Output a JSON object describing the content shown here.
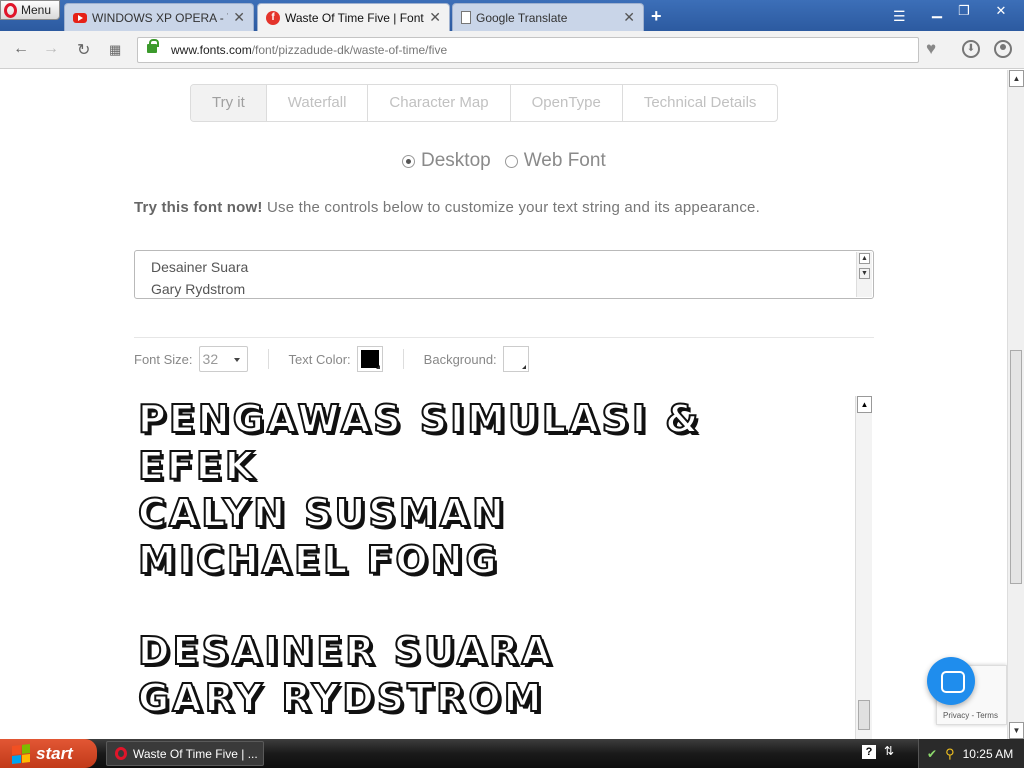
{
  "browser": {
    "menu_label": "Menu",
    "tabs": [
      {
        "title": "WINDOWS XP OPERA - YouTube",
        "favicon": "youtube-icon"
      },
      {
        "title": "Waste Of Time Five | Fonts.com",
        "favicon": "fonts-com-icon"
      },
      {
        "title": "Google Translate",
        "favicon": "document-icon"
      }
    ],
    "url_host": "www.fonts.com",
    "url_path": "/font/pizzadude-dk/waste-of-time/five"
  },
  "page": {
    "tabs": [
      "Try it",
      "Waterfall",
      "Character Map",
      "OpenType",
      "Technical Details"
    ],
    "selected_tab": "Try it",
    "radio_desktop": "Desktop",
    "radio_webfont": "Web Font",
    "intro_bold": "Try this font now!",
    "intro_text": " Use the controls below to customize your text string and its appearance.",
    "textarea_lines": [
      "Desainer Suara",
      "Gary Rydstrom"
    ],
    "font_size_label": "Font Size:",
    "font_size_value": "32",
    "text_color_label": "Text Color:",
    "text_color": "#000000",
    "background_label": "Background:",
    "background_color": "#ffffff",
    "preview_lines": [
      "Pengawas Simulasi &",
      "Efek",
      "Calyn Susman",
      "Michael Fong",
      "",
      "Desainer Suara",
      "Gary Rydstrom"
    ],
    "recaptcha_links": "Privacy - Terms"
  },
  "taskbar": {
    "start_label": "start",
    "task_label": "Waste Of Time Five | ...",
    "clock": "10:25 AM"
  }
}
